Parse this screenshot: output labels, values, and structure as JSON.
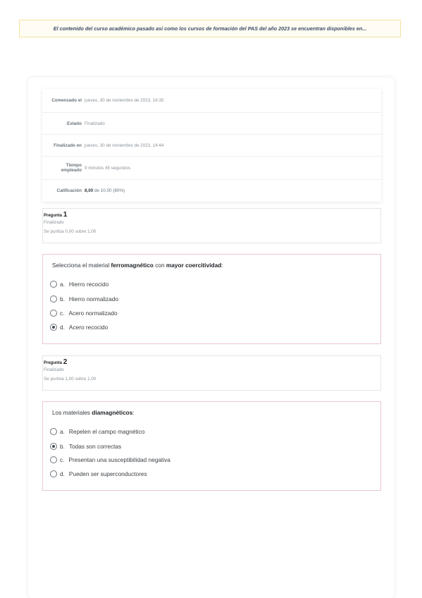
{
  "banner": {
    "text": "El contenido del curso académico pasado así como los cursos de formación del PAS del año 2023 se encuentran disponibles en..."
  },
  "summary": {
    "rows": [
      {
        "label": "Comenzado el",
        "value": "jueves, 30 de noviembre de 2023, 14:35"
      },
      {
        "label": "Estado",
        "value": "Finalizado"
      },
      {
        "label": "Finalizado en",
        "value": "jueves, 30 de noviembre de 2023, 14:44"
      },
      {
        "label": "Tiempo empleado",
        "value": "9 minutos 45 segundos"
      },
      {
        "label": "Calificación",
        "value_bold": "8,00",
        "value_rest": " de 10,00 (80%)"
      }
    ]
  },
  "questions": [
    {
      "title_prefix": "Pregunta",
      "number": "1",
      "status": "Finalizado",
      "score": "Se puntúa 0,00 sobre 1,00",
      "prompt_parts": [
        "Selecciona el material ",
        "ferromagnético",
        " con ",
        "mayor coercitividad",
        ":"
      ],
      "options": [
        {
          "letter": "a.",
          "text": "Hierro recocido",
          "selected": false
        },
        {
          "letter": "b.",
          "text": "Hierro normalizado",
          "selected": false
        },
        {
          "letter": "c.",
          "text": "Acero normalizado",
          "selected": false
        },
        {
          "letter": "d.",
          "text": "Acero recocido",
          "selected": true
        }
      ]
    },
    {
      "title_prefix": "Pregunta",
      "number": "2",
      "status": "Finalizado",
      "score": "Se puntúa 1,00 sobre 1,00",
      "prompt_parts": [
        "Los materiales ",
        "diamagnéticos",
        ":"
      ],
      "options": [
        {
          "letter": "a.",
          "text": "Repelen el campo magnético",
          "selected": false
        },
        {
          "letter": "b.",
          "text": "Todas son correctas",
          "selected": true
        },
        {
          "letter": "c.",
          "text": "Presentan una susceptibilidad negativa",
          "selected": false
        },
        {
          "letter": "d.",
          "text": "Pueden ser superconductores",
          "selected": false
        }
      ]
    }
  ]
}
